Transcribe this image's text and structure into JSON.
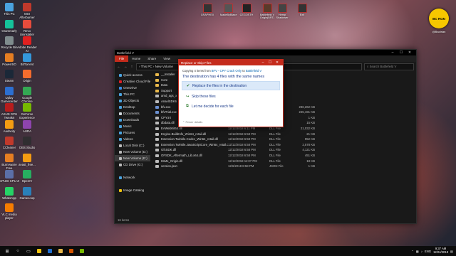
{
  "desktop_icons": [
    {
      "label": "This PC",
      "color": "#4aa3df"
    },
    {
      "label": "MSI Afterburner",
      "color": "#c0392b"
    },
    {
      "label": "Grammarly",
      "color": "#15c39a"
    },
    {
      "label": "Revo Uninstaller",
      "color": "#e74c3c"
    },
    {
      "label": "Recycle Bin",
      "color": "#7f8c8d"
    },
    {
      "label": "Adobe Reader XI",
      "color": "#e02020"
    },
    {
      "label": "PowerISO",
      "color": "#e67e22"
    },
    {
      "label": "BitTorrent",
      "color": "#3498db"
    },
    {
      "label": "Steam",
      "color": "#1b2838"
    },
    {
      "label": "Origin",
      "color": "#f56c2d"
    },
    {
      "label": "Uplay Gamecenter",
      "color": "#2c6fd1"
    },
    {
      "label": "Google Chrome",
      "color": "#34a853"
    },
    {
      "label": "ASUS GPU TweakII",
      "color": "#b71c1c"
    },
    {
      "label": "GeForce Experience",
      "color": "#76b900"
    },
    {
      "label": "Audacity",
      "color": "#f39c12"
    },
    {
      "label": "AURA",
      "color": "#8e44ad"
    },
    {
      "label": "CCleaner",
      "color": "#c0392b"
    },
    {
      "label": "OBS Studio",
      "color": "#302e31"
    },
    {
      "label": "BurnAware Free",
      "color": "#e67e22"
    },
    {
      "label": "avast_free...",
      "color": "#f39c12"
    },
    {
      "label": "CPUID CPU-Z",
      "color": "#5b6fa8"
    },
    {
      "label": "OpenIV",
      "color": "#27ae60"
    },
    {
      "label": "WhatsApp",
      "color": "#25d366"
    },
    {
      "label": "Gamecoop",
      "color": "#2980b9"
    },
    {
      "label": "VLC media player",
      "color": "#f57c00"
    }
  ],
  "top_icons": [
    {
      "label": "GRAPHEX",
      "color": "#333"
    },
    {
      "label": "MadeByBlaze",
      "color": "#555"
    },
    {
      "label": "CEGOSTH",
      "color": "#222"
    },
    {
      "label": "Battlefield V Origin(BRT)",
      "color": "#5a3a2a"
    },
    {
      "label": "Hemp Shadower",
      "color": "#444"
    },
    {
      "label": "Exit",
      "color": "#333"
    }
  ],
  "badge": {
    "text": "BC RGN",
    "sub": "@Bactrian"
  },
  "explorer": {
    "title": "Battlefield V",
    "ribbon_tabs": [
      "File",
      "Home",
      "Share",
      "View"
    ],
    "address": "› This PC › New Volume",
    "search_placeholder": "Search Battlefield V",
    "nav_items": [
      {
        "label": "Quick access",
        "color": "#4aa3df"
      },
      {
        "label": "Creative Cloud Files",
        "color": "#da1f26"
      },
      {
        "label": "OneDrive",
        "color": "#3b8ee8"
      },
      {
        "label": "This PC",
        "color": "#4aa3df"
      },
      {
        "label": "3D Objects",
        "color": "#4aa3df"
      },
      {
        "label": "Desktop",
        "color": "#4aa3df"
      },
      {
        "label": "Documents",
        "color": "#cfd8dc"
      },
      {
        "label": "Downloads",
        "color": "#4aa3df"
      },
      {
        "label": "Music",
        "color": "#4aa3df"
      },
      {
        "label": "Pictures",
        "color": "#4aa3df"
      },
      {
        "label": "Videos",
        "color": "#4aa3df"
      },
      {
        "label": "Local Disk (C:)",
        "color": "#bbb"
      },
      {
        "label": "New Volume (D:)",
        "color": "#bbb"
      },
      {
        "label": "New Volume (E:)",
        "color": "#bbb"
      },
      {
        "label": "CD Drive (G:)",
        "color": "#bbb"
      },
      {
        "label": "",
        "color": "transparent"
      },
      {
        "label": "Network",
        "color": "#4aa3df"
      },
      {
        "label": "",
        "color": "transparent"
      },
      {
        "label": "Image Catalog",
        "color": "#f1c40f"
      }
    ],
    "nav_selected": 13,
    "files": [
      {
        "name": "__Installer",
        "date": "",
        "type": "",
        "size": "",
        "color": "#e8b84a"
      },
      {
        "name": "Core",
        "date": "",
        "type": "",
        "size": "",
        "color": "#e8b84a"
      },
      {
        "name": "Data",
        "date": "",
        "type": "",
        "size": "",
        "color": "#e8b84a"
      },
      {
        "name": "Support",
        "date": "",
        "type": "",
        "size": "",
        "color": "#e8b84a"
      },
      {
        "name": "amd_ags_x",
        "date": "",
        "type": "",
        "size": "",
        "color": "#bbb"
      },
      {
        "name": "AnselSDK6",
        "date": "",
        "type": "",
        "size": "",
        "color": "#bbb"
      },
      {
        "name": "bfv.exe",
        "date": "",
        "type": "",
        "size": "236,262 KB",
        "color": "#6a8fd0"
      },
      {
        "name": "bfvTrial.exe",
        "date": "",
        "type": "",
        "size": "245,191 KB",
        "color": "#6a8fd0"
      },
      {
        "name": "CPY.ini",
        "date": "",
        "type": "",
        "size": "1 KB",
        "color": "#bbb"
      },
      {
        "name": "dbdata.dll",
        "date": "12/11/2018 6:20 PM",
        "type": "DLL File",
        "size": "15 KB",
        "color": "#bbb"
      },
      {
        "name": "EAWebKit64.dll",
        "date": "12/12/2018 6:11 PM",
        "type": "DLL File",
        "size": "21,032 KB",
        "color": "#bbb"
      },
      {
        "name": "Engine.BuildInfo_Win64_retail.dll",
        "date": "12/12/2018 6:58 PM",
        "type": "DLL File",
        "size": "21 KB",
        "color": "#bbb"
      },
      {
        "name": "Extension.Twinkle.Codec_Win64_retail.dll",
        "date": "12/12/2018 6:58 PM",
        "type": "DLL File",
        "size": "952 KB",
        "color": "#bbb"
      },
      {
        "name": "Extension.Twinkle.JavaScriptCore_Win64_retail.dll",
        "date": "12/12/2018 6:58 PM",
        "type": "DLL File",
        "size": "2,578 KB",
        "color": "#bbb"
      },
      {
        "name": "GfxSDK.dll",
        "date": "12/12/2018 6:58 PM",
        "type": "DLL File",
        "size": "4,121 KB",
        "color": "#bbb"
      },
      {
        "name": "OFSDK_Aftermath_Lib.x64.dll",
        "date": "12/12/2018 6:58 PM",
        "type": "DLL File",
        "size": "451 KB",
        "color": "#bbb"
      },
      {
        "name": "ItsMe_Origin.dll",
        "date": "12/12/2018 11:07 PM",
        "type": "DLL File",
        "size": "18 KB",
        "color": "#bbb"
      },
      {
        "name": "version.json",
        "date": "12/6/2018 8:58 PM",
        "type": "JSON File",
        "size": "1 KB",
        "color": "#bbb"
      }
    ],
    "status": "16 items"
  },
  "dialog": {
    "title": "Replace or Skip Files",
    "copying_prefix": "Copying 4 items from",
    "source": "BFV - CPY Crack Only",
    "to_word": "to",
    "dest": "Battlefield V",
    "heading": "The destination has 4 files with the same names",
    "options": [
      {
        "label": "Replace the files in the destination",
        "icon": "✔"
      },
      {
        "label": "Skip these files",
        "icon": "↪"
      },
      {
        "label": "Let me decide for each file",
        "icon": "⧉"
      }
    ],
    "selected_option": 0,
    "fewer": "Fewer details"
  },
  "taskbar": {
    "time": "9:37 AM",
    "date": "12/24/2018",
    "lang": "ENG"
  }
}
